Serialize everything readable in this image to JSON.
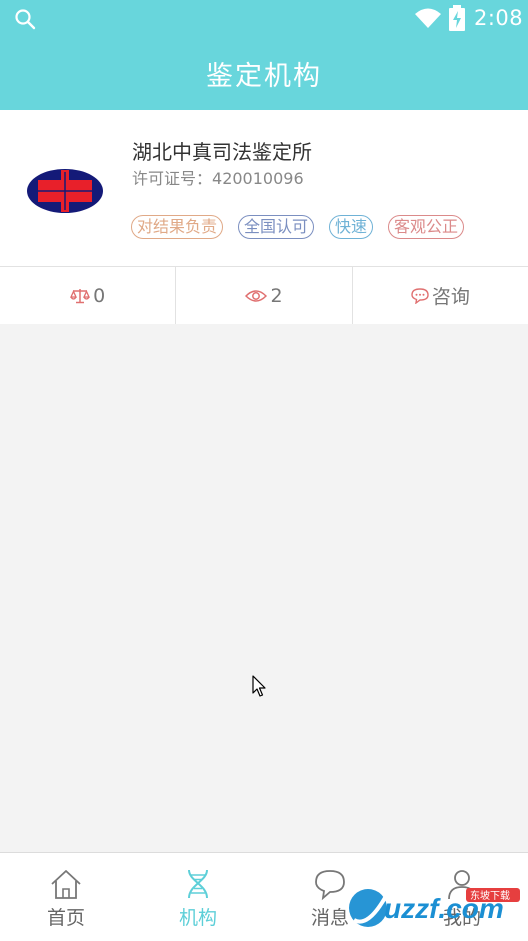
{
  "status_bar": {
    "time": "2:08"
  },
  "header": {
    "title": "鉴定机构"
  },
  "org": {
    "name": "湖北中真司法鉴定所",
    "license_label": "许可证号：",
    "license_number": "420010096",
    "tags": [
      {
        "label": "对结果负责",
        "color": "#e0a987"
      },
      {
        "label": "全国认可",
        "color": "#7b8fc0"
      },
      {
        "label": "快速",
        "color": "#6fb2d6"
      },
      {
        "label": "客观公正",
        "color": "#db8a8a"
      }
    ]
  },
  "stats": {
    "scale_count": "0",
    "view_count": "2",
    "consult_label": "咨询"
  },
  "tab_bar": {
    "items": [
      {
        "label": "首页",
        "icon": "home-icon"
      },
      {
        "label": "机构",
        "icon": "dna-icon",
        "active": true
      },
      {
        "label": "消息",
        "icon": "chat-bubble-icon"
      },
      {
        "label": "我的",
        "icon": "user-icon"
      }
    ],
    "active_color": "#5dcfd8"
  },
  "watermark": {
    "text": "uzzf.com",
    "badge": "东坡下载"
  },
  "colors": {
    "primary": "#68d6dc",
    "background": "#f3f3f3"
  }
}
